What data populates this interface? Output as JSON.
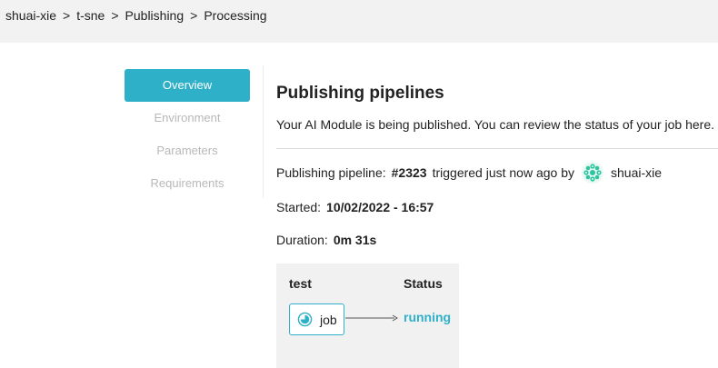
{
  "breadcrumb": {
    "items": [
      "shuai-xie",
      "t-sne",
      "Publishing",
      "Processing"
    ],
    "separator": ">"
  },
  "sidebar": {
    "items": [
      {
        "label": "Overview",
        "active": true
      },
      {
        "label": "Environment",
        "active": false
      },
      {
        "label": "Parameters",
        "active": false
      },
      {
        "label": "Requirements",
        "active": false
      }
    ]
  },
  "main": {
    "title": "Publishing pipelines",
    "description": "Your AI Module is being published. You can review the status of your job here.",
    "pipeline": {
      "label": "Publishing pipeline:",
      "id": "#2323",
      "trigger_text": "triggered just now ago by",
      "user": "shuai-xie",
      "user_icon": "user-avatar-icon"
    },
    "started": {
      "label": "Started:",
      "value": "10/02/2022 - 16:57"
    },
    "duration": {
      "label": "Duration:",
      "value": "0m 31s"
    }
  },
  "graph": {
    "stage_header": "test",
    "status_header": "Status",
    "job": {
      "label": "job",
      "icon": "running-status-icon",
      "status": "running"
    }
  },
  "colors": {
    "accent": "#2eb0c8",
    "breadcrumb_bg": "#f2f2f2",
    "graph_bg": "#f1f1f1",
    "avatar": "#2ec4a0"
  }
}
